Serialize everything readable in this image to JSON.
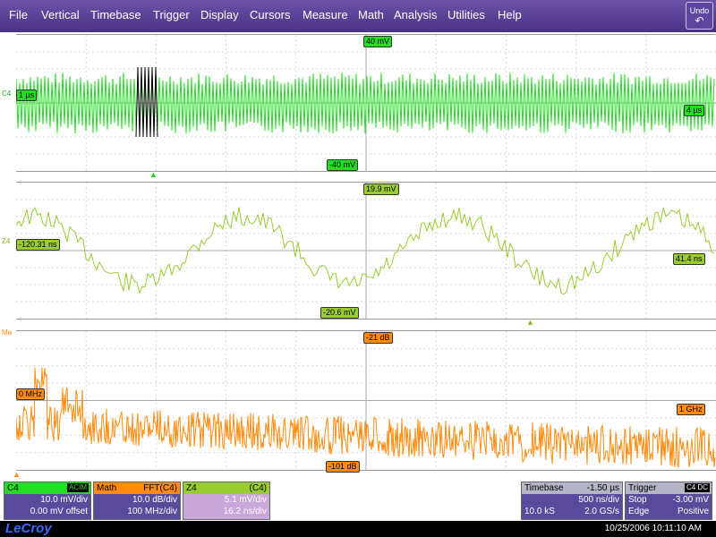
{
  "menu": [
    "File",
    "Vertical",
    "Timebase",
    "Trigger",
    "Display",
    "Cursors",
    "Measure",
    "Math",
    "Analysis",
    "Utilities",
    "Help"
  ],
  "undo": {
    "label": "Undo",
    "icon": "undo-arrow-icon"
  },
  "grid1": {
    "channel_label": "C4",
    "top": "40 mV",
    "bottom": "-40 mV",
    "left": "1 µs",
    "right": "4 µs",
    "trace_color": "#22dd22"
  },
  "grid2": {
    "channel_label": "Z4",
    "top": "19.9 mV",
    "bottom": "-20.6 mV",
    "left": "-120.31 ns",
    "right": "41.4 ns",
    "trace_color": "#99cc33"
  },
  "grid3": {
    "channel_label": "Ma",
    "top": "-21 dB",
    "bottom": "-101 dB",
    "left": "0 MHz",
    "right": "1 GHz",
    "trace_color": "#ff8c10"
  },
  "c4": {
    "name": "C4",
    "coupling": "ACIM",
    "line1": "10.0 mV/div",
    "line2": "0.00 mV offset",
    "color": "#22dd22"
  },
  "math": {
    "name": "Math",
    "fn": "FFT(C4)",
    "line1": "10.0 dB/div",
    "line2": "100 MHz/div",
    "color": "#ff8c10"
  },
  "z4": {
    "name": "Z4",
    "src": "(C4)",
    "line1": "5.1 mV/div",
    "line2": "16.2 ns/div",
    "color": "#99cc33"
  },
  "timebase": {
    "title": "Timebase",
    "delay": "-1.50 µs",
    "r1l": "",
    "r1r": "500 ns/div",
    "r2l": "10.0 kS",
    "r2r": "2.0 GS/s"
  },
  "trigger": {
    "title": "Trigger",
    "badge": "C4 DC",
    "r1l": "Stop",
    "r1r": "-3.00 mV",
    "r2l": "Edge",
    "r2r": "Positive"
  },
  "status": {
    "logo": "LeCroy",
    "datetime": "10/25/2006 10:11:10 AM"
  }
}
